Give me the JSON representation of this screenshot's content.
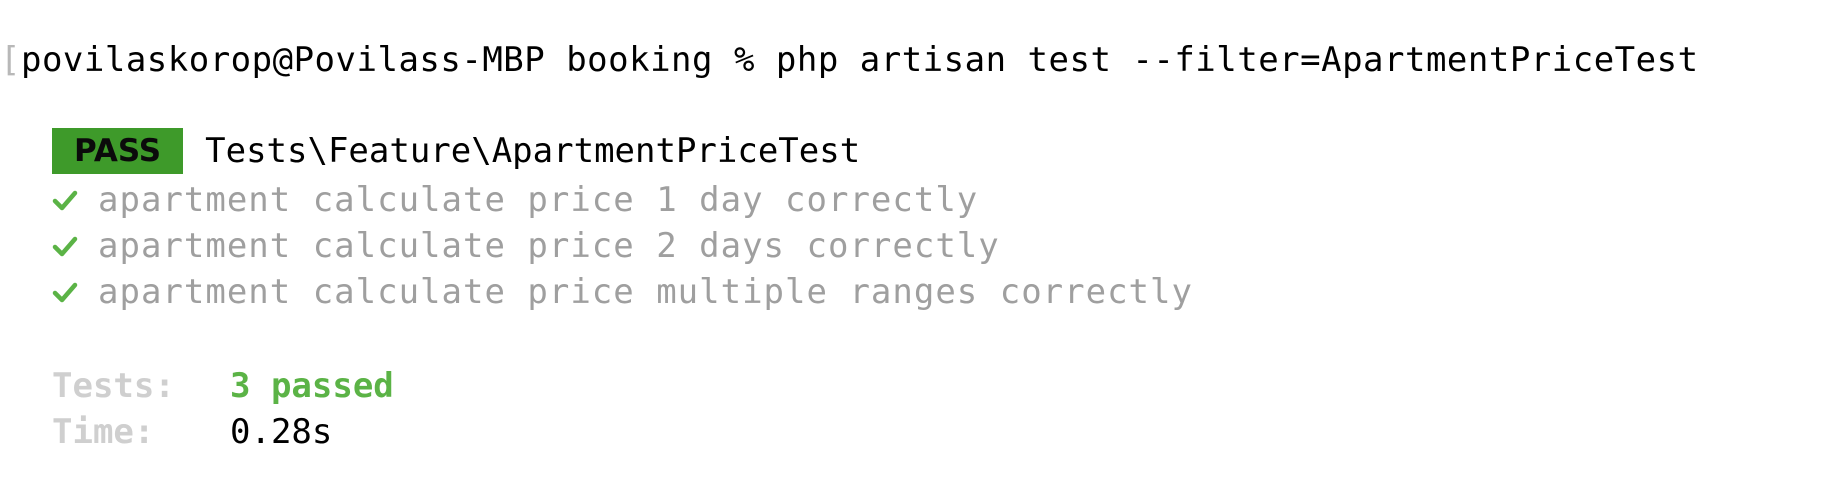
{
  "terminal": {
    "prompt_marker": "[",
    "command_line": "povilaskorop@Povilass-MBP booking % php artisan test --filter=ApartmentPriceTest"
  },
  "result": {
    "status": "PASS",
    "suite": "Tests\\Feature\\ApartmentPriceTest",
    "tests": [
      {
        "name": "apartment calculate price 1 day correctly"
      },
      {
        "name": "apartment calculate price 2 days correctly"
      },
      {
        "name": "apartment calculate price multiple ranges correctly"
      }
    ]
  },
  "summary": {
    "tests_label": "Tests:",
    "tests_value": "3 passed",
    "time_label": "Time:",
    "time_value": "0.28s"
  },
  "colors": {
    "pass_badge_bg": "#3e9a2a",
    "check": "#5bb346",
    "muted_text": "#9f9f9f",
    "summary_label": "#cfcfcf"
  },
  "icons": {
    "test_status": "checkmark-icon"
  }
}
